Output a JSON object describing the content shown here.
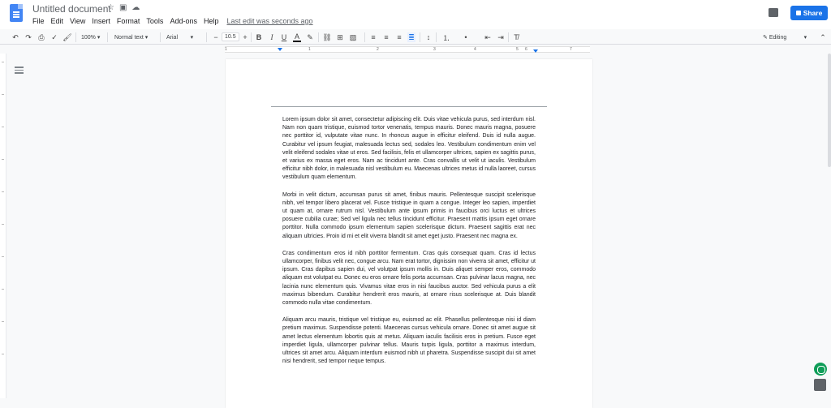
{
  "app": {
    "title": "Untitled document",
    "menus": [
      "File",
      "Edit",
      "View",
      "Insert",
      "Format",
      "Tools",
      "Add-ons",
      "Help"
    ],
    "last_edit": "Last edit was seconds ago",
    "share_label": "Share"
  },
  "toolbar": {
    "zoom": "100%",
    "style": "Normal text",
    "font": "Arial",
    "font_size": "10.5",
    "mode": "Editing"
  },
  "ruler": {
    "numbers": [
      "1",
      "1",
      "2",
      "3",
      "4",
      "5",
      "6",
      "7"
    ]
  },
  "document": {
    "paragraphs": [
      "Lorem ipsum dolor sit amet, consectetur adipiscing elit. Duis vitae vehicula purus, sed interdum nisl. Nam non quam tristique, euismod tortor venenatis, tempus mauris. Donec mauris magna, posuere nec porttitor id, vulputate vitae nunc. In rhoncus augue in efficitur eleifend. Duis id nulla augue. Curabitur vel ipsum feugiat, malesuada lectus sed, sodales leo. Vestibulum condimentum enim vel velit eleifend sodales vitae ut eros. Sed facilisis, felis et ullamcorper ultrices, sapien ex sagittis purus, et varius ex massa eget eros. Nam ac tincidunt ante. Cras convallis ut velit ut iaculis. Vestibulum efficitur nibh dolor, in malesuada nisl vestibulum eu. Maecenas ultrices metus id nulla laoreet, cursus vestibulum quam elementum.",
      "Morbi in velit dictum, accumsan purus sit amet, finibus mauris. Pellentesque suscipit scelerisque nibh, vel tempor libero placerat vel. Fusce tristique in quam a congue. Integer leo sapien, imperdiet ut quam at, ornare rutrum nisl. Vestibulum ante ipsum primis in faucibus orci luctus et ultrices posuere cubilia curae; Sed vel ligula nec tellus tincidunt efficitur. Praesent mattis ipsum eget ornare porttitor. Nulla commodo ipsum elementum sapien scelerisque dictum. Praesent sagittis erat nec aliquam ultricies. Proin id mi et elit viverra blandit sit amet eget justo. Praesent nec magna ex.",
      "Cras condimentum eros id nibh porttitor fermentum. Cras quis consequat quam. Cras id lectus ullamcorper, finibus velit nec, congue arcu. Nam erat tortor, dignissim non viverra sit amet, efficitur ut ipsum. Cras dapibus sapien dui, vel volutpat ipsum mollis in. Duis aliquet semper eros, commodo aliquam est volutpat eu. Donec eu eros ornare felis porta accumsan. Cras pulvinar lacus magna, nec lacinia nunc elementum quis. Vivamus vitae eros in nisi faucibus auctor. Sed vehicula purus a elit maximus bibendum. Curabitur hendrerit eros mauris, at ornare risus scelerisque at. Duis blandit commodo nulla vitae condimentum.",
      "Aliquam arcu mauris, tristique vel tristique eu, euismod ac elit. Phasellus pellentesque nisi id diam pretium maximus. Suspendisse potenti. Maecenas cursus vehicula ornare. Donec sit amet augue sit amet lectus elementum lobortis quis at metus. Aliquam iaculis facilisis eros in pretium. Fusce eget imperdiet ligula, ullamcorper pulvinar tellus. Mauris turpis ligula, porttitor a maximus interdum, ultrices sit amet arcu. Aliquam interdum euismod nibh ut pharetra. Suspendisse suscipit dui sit amet nisi hendrerit, sed tempor neque tempus."
    ]
  },
  "colors": {
    "accent": "#1a73e8",
    "docs_blue": "#4285f4"
  }
}
